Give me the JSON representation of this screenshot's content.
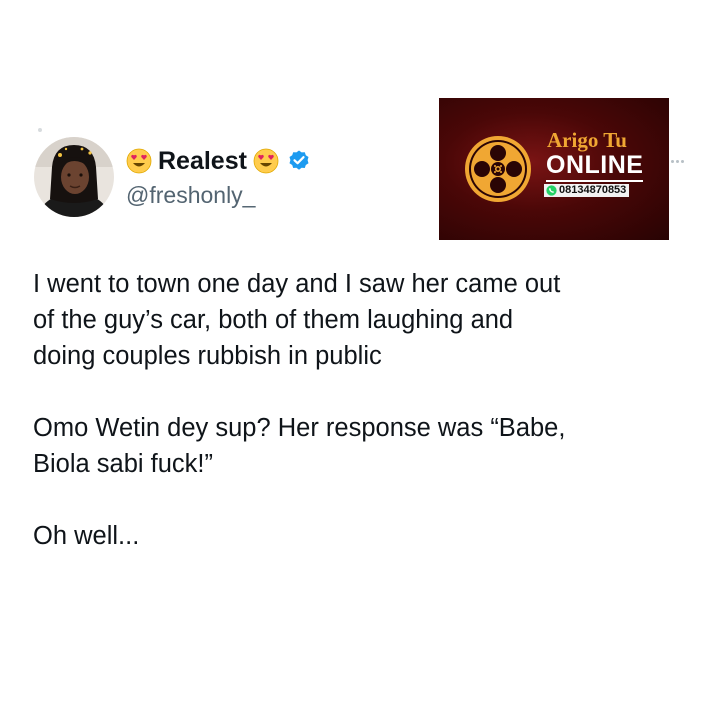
{
  "tweet": {
    "display_name": "Realest",
    "handle": "@freshonly_",
    "name_prefix_icon": "heart-eyes-emoji",
    "name_suffix_icon": "heart-eyes-emoji",
    "verified_icon": "verified-badge-icon",
    "paragraphs": [
      "I went to town one day and I saw her came out\nof the guy’s car, both of them laughing and\ndoing couples rubbish in public",
      "Omo Wetin dey sup? Her response was “Babe,\nBiola sabi fuck!”",
      "Oh well..."
    ]
  },
  "ad": {
    "brand": "Arigo Tu",
    "tagline": "ONLINE",
    "phone": "08134870853",
    "logo_icon": "film-reel-icon",
    "phone_icon": "whatsapp-icon"
  },
  "menu": {
    "icon": "more-options-icon"
  },
  "colors": {
    "text": "#0f1419",
    "handle": "#536471",
    "verified": "#1d9bf0",
    "ad_background": "#4a0707",
    "ad_accent": "#f0a733"
  }
}
